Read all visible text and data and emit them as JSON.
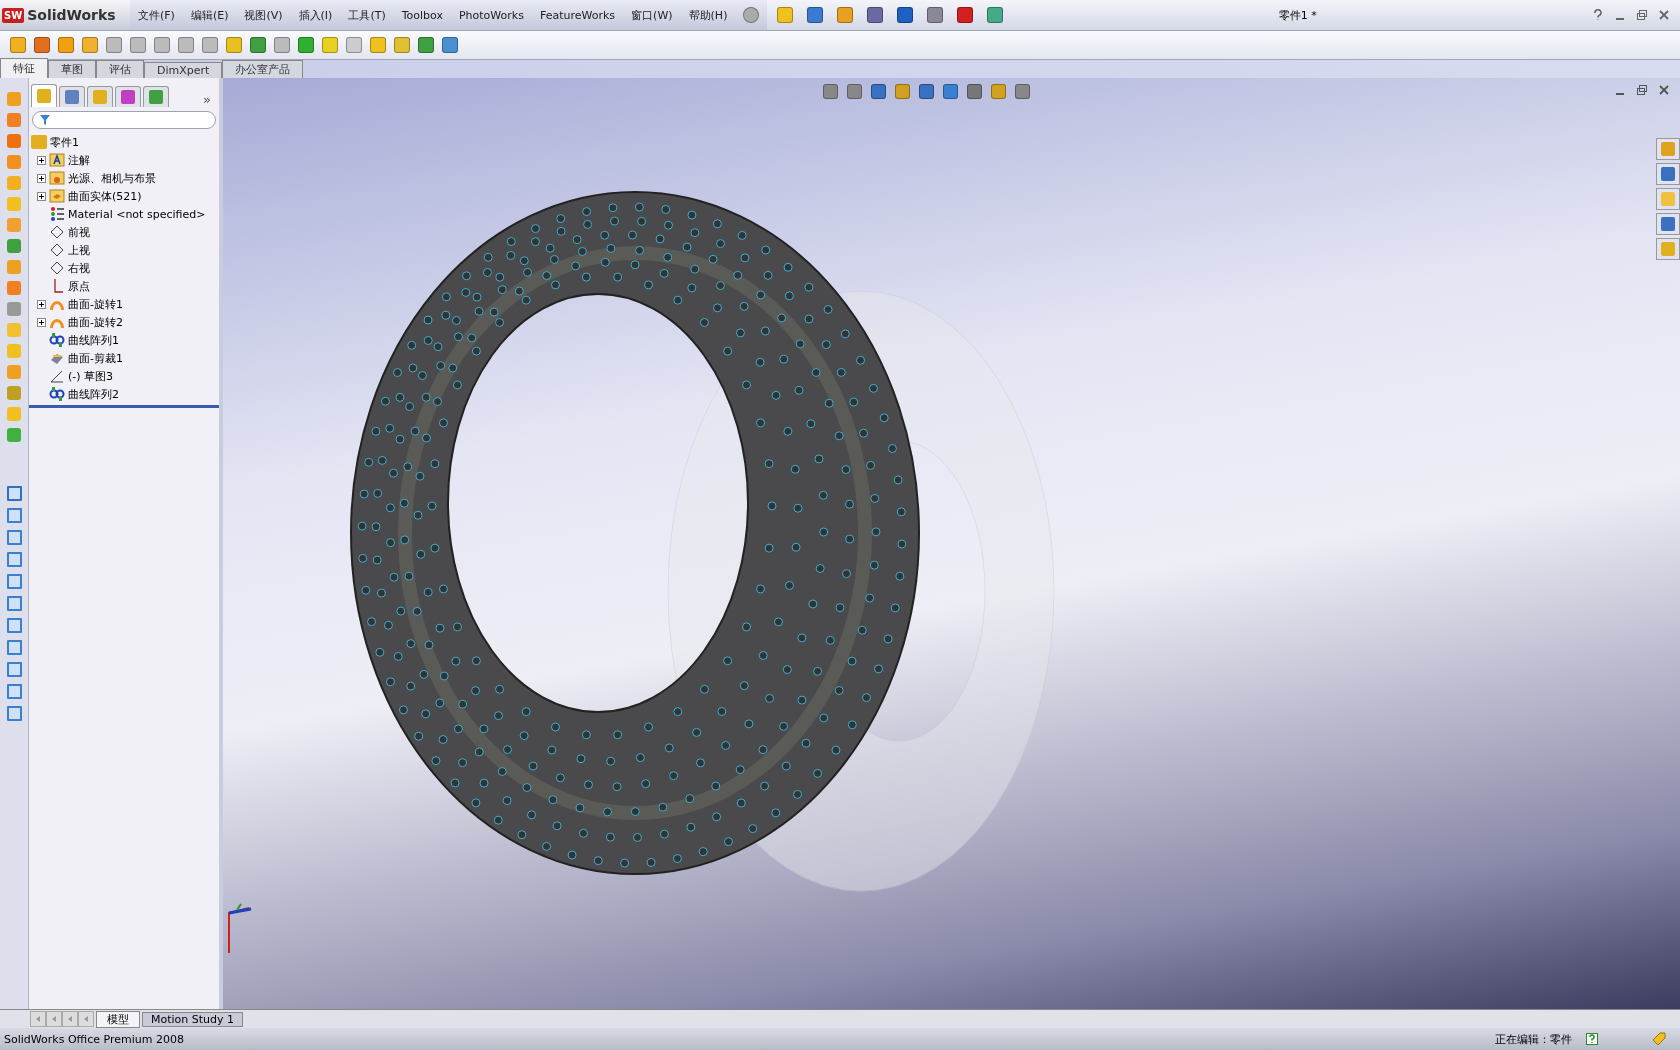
{
  "app": {
    "logo_badge": "SW",
    "logo_name": "SolidWorks"
  },
  "menu": [
    "文件(F)",
    "编辑(E)",
    "视图(V)",
    "插入(I)",
    "工具(T)",
    "Toolbox",
    "PhotoWorks",
    "FeatureWorks",
    "窗口(W)",
    "帮助(H)"
  ],
  "window": {
    "title": "零件1 *"
  },
  "command_tabs": [
    {
      "label": "特征",
      "selected": true
    },
    {
      "label": "草图",
      "selected": false
    },
    {
      "label": "评估",
      "selected": false
    },
    {
      "label": "DimXpert",
      "selected": false
    },
    {
      "label": "办公室产品",
      "selected": false
    }
  ],
  "panel_tabs": [
    {
      "selected": true
    },
    {
      "selected": false
    },
    {
      "selected": false
    },
    {
      "selected": false
    },
    {
      "selected": false
    }
  ],
  "feature_tree": {
    "more": "»",
    "root": {
      "label": "零件1",
      "children": [
        {
          "label": "注解",
          "kind": "annotation",
          "expander": true
        },
        {
          "label": "光源、相机与布景",
          "kind": "lights",
          "expander": true
        },
        {
          "label": "曲面实体(521)",
          "kind": "surface-body",
          "expander": true
        },
        {
          "label": "Material <not specified>",
          "kind": "material",
          "expander": false
        },
        {
          "label": "前视",
          "kind": "plane",
          "expander": false
        },
        {
          "label": "上视",
          "kind": "plane",
          "expander": false
        },
        {
          "label": "右视",
          "kind": "plane",
          "expander": false
        },
        {
          "label": "原点",
          "kind": "origin",
          "expander": false
        },
        {
          "label": "曲面-旋转1",
          "kind": "revolve",
          "expander": true
        },
        {
          "label": "曲面-旋转2",
          "kind": "revolve",
          "expander": true
        },
        {
          "label": "曲线阵列1",
          "kind": "pattern",
          "expander": false
        },
        {
          "label": "曲面-剪裁1",
          "kind": "trim",
          "expander": false
        },
        {
          "label": "(-) 草图3",
          "kind": "sketch",
          "expander": false
        },
        {
          "label": "曲线阵列2",
          "kind": "pattern",
          "expander": false
        }
      ]
    }
  },
  "bottom_tabs": [
    {
      "label": "模型",
      "selected": true
    },
    {
      "label": "Motion Study 1",
      "selected": false
    }
  ],
  "status_bar": {
    "product": "SolidWorks Office Premium 2008",
    "mode": "正在编辑：零件"
  }
}
